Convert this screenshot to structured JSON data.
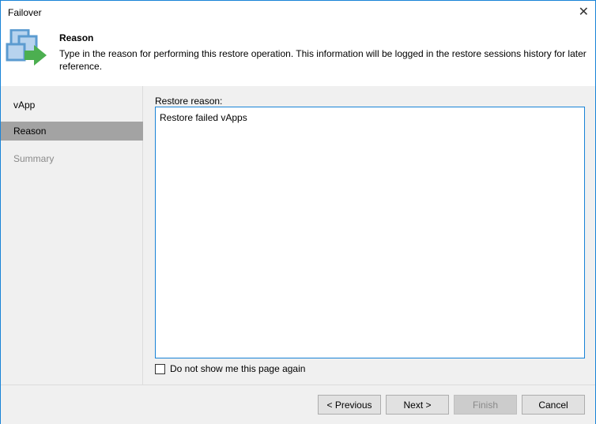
{
  "window": {
    "title": "Failover"
  },
  "header": {
    "title": "Reason",
    "description": "Type in the reason for performing this restore operation. This information will be logged in the restore sessions history for later reference."
  },
  "sidebar": {
    "items": [
      {
        "label": "vApp"
      },
      {
        "label": "Reason"
      },
      {
        "label": "Summary"
      }
    ]
  },
  "main": {
    "reason_label": "Restore reason:",
    "reason_value": "Restore failed vApps",
    "checkbox_label": "Do not show me this page again"
  },
  "footer": {
    "previous": "< Previous",
    "next": "Next >",
    "finish": "Finish",
    "cancel": "Cancel"
  }
}
